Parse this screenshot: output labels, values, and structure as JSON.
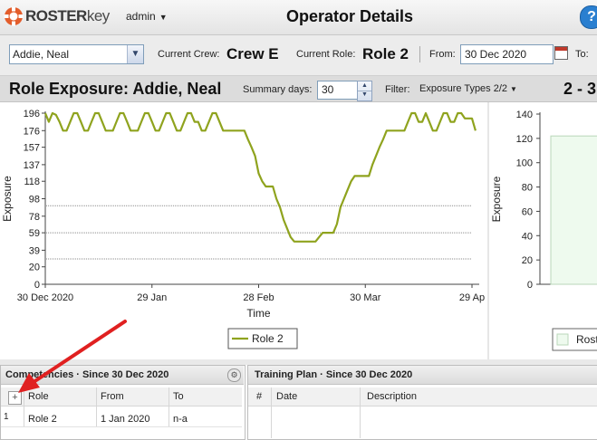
{
  "app": {
    "logo_text": "ROSTER",
    "logo_text_key": "key",
    "user_menu": "admin",
    "page_title": "Operator Details",
    "help_label": "?"
  },
  "operator_bar": {
    "operator_value": "Addie, Neal",
    "current_crew_label": "Current Crew:",
    "current_crew_value": "Crew E",
    "current_role_label": "Current Role:",
    "current_role_value": "Role 2",
    "from_label": "From:",
    "from_value": "30 Dec 2020",
    "to_label": "To:"
  },
  "section": {
    "title": "Role Exposure: Addie, Neal",
    "summary_days_label": "Summary days:",
    "summary_days_value": "30",
    "filter_label": "Filter:",
    "filter_value": "Exposure Types 2/2",
    "right_title": "2 - 3"
  },
  "colors": {
    "series": "#8fa31e",
    "right_bar_fill": "#eefaee",
    "right_bar_stroke": "#b9d7b9",
    "annotation_arrow": "#e02020"
  },
  "chart_data": [
    {
      "type": "line",
      "title": "",
      "xlabel": "Time",
      "ylabel": "Exposure",
      "yticks": [
        0,
        20,
        39,
        59,
        78,
        98,
        118,
        137,
        157,
        176,
        196
      ],
      "ylim": [
        0,
        196
      ],
      "xlim_days": [
        0,
        120
      ],
      "xticks": [
        {
          "day": 0,
          "label": "30 Dec 2020"
        },
        {
          "day": 30,
          "label": "29 Jan"
        },
        {
          "day": 60,
          "label": "28 Feb"
        },
        {
          "day": 90,
          "label": "30 Mar"
        },
        {
          "day": 120,
          "label": "29 Ap"
        }
      ],
      "threshold_lines": [
        29,
        59,
        90
      ],
      "legend": "bottom-center",
      "series": [
        {
          "name": "Role 2",
          "points": [
            [
              0,
              196
            ],
            [
              1,
              186
            ],
            [
              2,
              196
            ],
            [
              3,
              194
            ],
            [
              4,
              186
            ],
            [
              5,
              176
            ],
            [
              6,
              176
            ],
            [
              7,
              186
            ],
            [
              8,
              196
            ],
            [
              9,
              196
            ],
            [
              10,
              186
            ],
            [
              11,
              176
            ],
            [
              12,
              176
            ],
            [
              13,
              186
            ],
            [
              14,
              196
            ],
            [
              15,
              196
            ],
            [
              16,
              186
            ],
            [
              17,
              176
            ],
            [
              18,
              176
            ],
            [
              19,
              176
            ],
            [
              20,
              186
            ],
            [
              21,
              196
            ],
            [
              22,
              196
            ],
            [
              23,
              186
            ],
            [
              24,
              176
            ],
            [
              25,
              176
            ],
            [
              26,
              176
            ],
            [
              27,
              186
            ],
            [
              28,
              196
            ],
            [
              29,
              196
            ],
            [
              30,
              186
            ],
            [
              31,
              176
            ],
            [
              32,
              176
            ],
            [
              33,
              186
            ],
            [
              34,
              196
            ],
            [
              35,
              196
            ],
            [
              36,
              186
            ],
            [
              37,
              176
            ],
            [
              38,
              176
            ],
            [
              39,
              186
            ],
            [
              40,
              196
            ],
            [
              41,
              196
            ],
            [
              42,
              186
            ],
            [
              43,
              186
            ],
            [
              44,
              176
            ],
            [
              45,
              176
            ],
            [
              46,
              186
            ],
            [
              47,
              196
            ],
            [
              48,
              196
            ],
            [
              49,
              186
            ],
            [
              50,
              176
            ],
            [
              51,
              176
            ],
            [
              52,
              176
            ],
            [
              53,
              176
            ],
            [
              54,
              176
            ],
            [
              55,
              176
            ],
            [
              56,
              176
            ],
            [
              57,
              166
            ],
            [
              58,
              157
            ],
            [
              59,
              147
            ],
            [
              60,
              127
            ],
            [
              61,
              118
            ],
            [
              62,
              112
            ],
            [
              63,
              112
            ],
            [
              64,
              112
            ],
            [
              65,
              98
            ],
            [
              66,
              88
            ],
            [
              67,
              74
            ],
            [
              68,
              64
            ],
            [
              69,
              54
            ],
            [
              70,
              49
            ],
            [
              71,
              49
            ],
            [
              72,
              49
            ],
            [
              73,
              49
            ],
            [
              74,
              49
            ],
            [
              75,
              49
            ],
            [
              76,
              49
            ],
            [
              77,
              54
            ],
            [
              78,
              59
            ],
            [
              79,
              59
            ],
            [
              80,
              59
            ],
            [
              81,
              59
            ],
            [
              82,
              69
            ],
            [
              83,
              88
            ],
            [
              84,
              98
            ],
            [
              85,
              108
            ],
            [
              86,
              118
            ],
            [
              87,
              124
            ],
            [
              88,
              124
            ],
            [
              89,
              124
            ],
            [
              90,
              124
            ],
            [
              91,
              124
            ],
            [
              92,
              137
            ],
            [
              93,
              147
            ],
            [
              94,
              157
            ],
            [
              95,
              166
            ],
            [
              96,
              176
            ],
            [
              97,
              176
            ],
            [
              98,
              176
            ],
            [
              99,
              176
            ],
            [
              100,
              176
            ],
            [
              101,
              176
            ],
            [
              102,
              186
            ],
            [
              103,
              196
            ],
            [
              104,
              196
            ],
            [
              105,
              186
            ],
            [
              106,
              186
            ],
            [
              107,
              196
            ],
            [
              108,
              186
            ],
            [
              109,
              176
            ],
            [
              110,
              176
            ],
            [
              111,
              186
            ],
            [
              112,
              196
            ],
            [
              113,
              196
            ],
            [
              114,
              186
            ],
            [
              115,
              186
            ],
            [
              116,
              196
            ],
            [
              117,
              196
            ],
            [
              118,
              190
            ],
            [
              119,
              190
            ],
            [
              120,
              190
            ],
            [
              121,
              176
            ]
          ]
        }
      ]
    },
    {
      "type": "bar",
      "title": "",
      "ylabel": "Exposure",
      "yticks": [
        0,
        20,
        40,
        60,
        80,
        100,
        120,
        140
      ],
      "ylim": [
        0,
        140
      ],
      "values": [
        122
      ],
      "legend_partial": "Rost"
    }
  ],
  "competencies": {
    "title": "Competencies · Since 30 Dec 2020",
    "columns": [
      "Role",
      "From",
      "To"
    ],
    "rows": [
      {
        "num": "1",
        "role": "Role 2",
        "from": "1 Jan 2020",
        "to": "n-a"
      }
    ],
    "add_label": "+"
  },
  "training_plan": {
    "title": "Training Plan · Since 30 Dec 2020",
    "columns": [
      "#",
      "Date",
      "Description"
    ]
  }
}
